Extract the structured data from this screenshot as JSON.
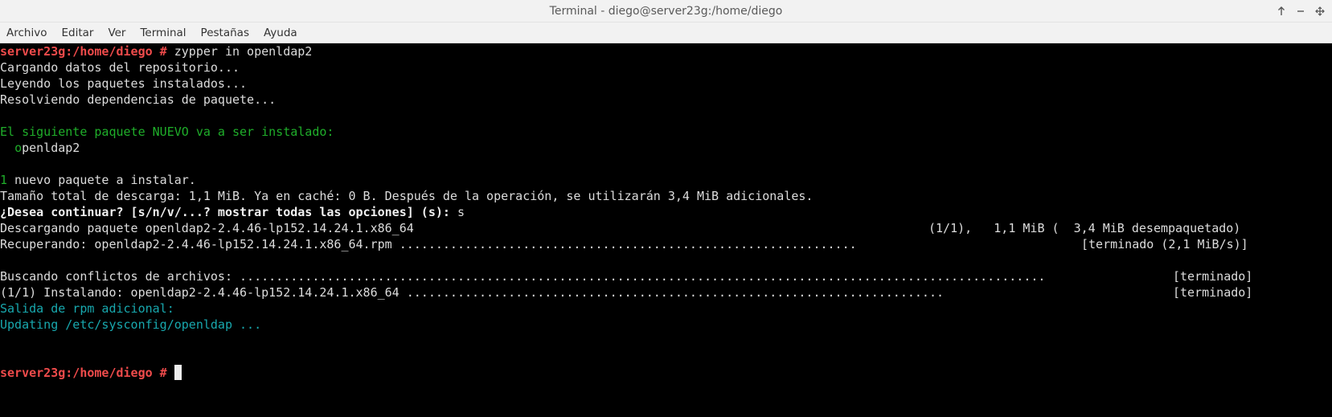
{
  "window": {
    "title": "Terminal - diego@server23g:/home/diego"
  },
  "menu": [
    "Archivo",
    "Editar",
    "Ver",
    "Terminal",
    "Pestañas",
    "Ayuda"
  ],
  "terminal": {
    "prompt": "server23g:/home/diego #",
    "command": " zypper in openldap2",
    "line_load": "Cargando datos del repositorio...",
    "line_read": "Leyendo los paquetes instalados...",
    "line_resolve": "Resolviendo dependencias de paquete...",
    "new_pkg_header": "El siguiente paquete NUEVO va a ser instalado:",
    "pkg_first_letter": "o",
    "pkg_rest": "penldap2",
    "count_num": "1",
    "count_text": " nuevo paquete a instalar.",
    "size_line": "Tamaño total de descarga: 1,1 MiB. Ya en caché: 0 B. Después de la operación, se utilizarán 3,4 MiB adicionales.",
    "confirm_prompt": "¿Desea continuar? [s/n/v/...? mostrar todas las opciones] (s):",
    "confirm_answer": " s",
    "download_left": "Descargando paquete openldap2-2.4.46-lp152.14.24.1.x86_64",
    "download_right": "(1/1),   1,1 MiB (  3,4 MiB desempaquetado)",
    "retrieve_left": "Recuperando: openldap2-2.4.46-lp152.14.24.1.x86_64.rpm ...............................................................",
    "retrieve_right": "[terminado (2,1 MiB/s)]",
    "conflicts_left": "Buscando conflictos de archivos: ...............................................................................................................",
    "conflicts_right": "[terminado]",
    "install_left": "(1/1) Instalando: openldap2-2.4.46-lp152.14.24.1.x86_64 ..........................................................................",
    "install_right": "[terminado]",
    "rpm_output_header": "Salida de rpm adicional:",
    "updating_line": "Updating /etc/sysconfig/openldap ..."
  },
  "colors": {
    "prompt": "#ef4b4b",
    "green": "#1fae2a",
    "cyan": "#18a8ae"
  },
  "icons": [
    "maximize-up-icon",
    "minimize-icon",
    "resize-icon"
  ]
}
